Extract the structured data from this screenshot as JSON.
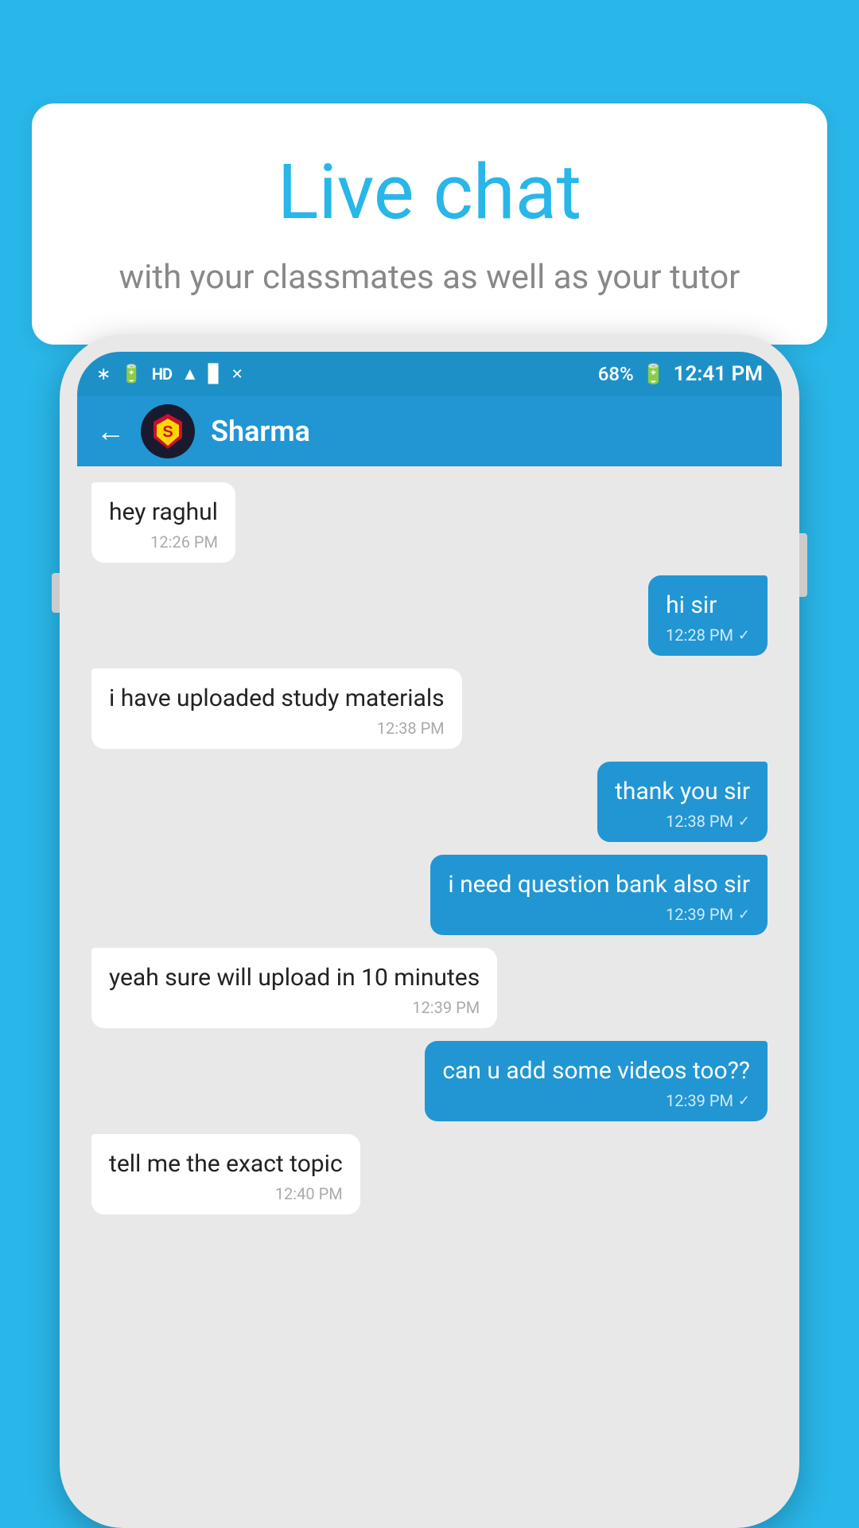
{
  "background": {
    "color": "#29b6e8"
  },
  "speech_bubble": {
    "title": "Live chat",
    "subtitle": "with your classmates as well as your tutor"
  },
  "phone": {
    "status_bar": {
      "time": "12:41 PM",
      "battery": "68%",
      "icons": "bluetooth, vibrate, HD, wifi, signal, battery"
    },
    "chat_header": {
      "contact_name": "Sharma",
      "back_label": "←"
    },
    "messages": [
      {
        "id": 1,
        "type": "received",
        "text": "hey raghul",
        "time": "12:26 PM",
        "tick": ""
      },
      {
        "id": 2,
        "type": "sent",
        "text": "hi sir",
        "time": "12:28 PM",
        "tick": "✓"
      },
      {
        "id": 3,
        "type": "received",
        "text": "i have uploaded study materials",
        "time": "12:38 PM",
        "tick": ""
      },
      {
        "id": 4,
        "type": "sent",
        "text": "thank you sir",
        "time": "12:38 PM",
        "tick": "✓"
      },
      {
        "id": 5,
        "type": "sent",
        "text": "i need question bank also sir",
        "time": "12:39 PM",
        "tick": "✓"
      },
      {
        "id": 6,
        "type": "received",
        "text": "yeah sure will upload in 10 minutes",
        "time": "12:39 PM",
        "tick": ""
      },
      {
        "id": 7,
        "type": "sent",
        "text": "can u add some videos too??",
        "time": "12:39 PM",
        "tick": "✓"
      },
      {
        "id": 8,
        "type": "received",
        "text": "tell me the exact topic",
        "time": "12:40 PM",
        "tick": ""
      }
    ]
  }
}
